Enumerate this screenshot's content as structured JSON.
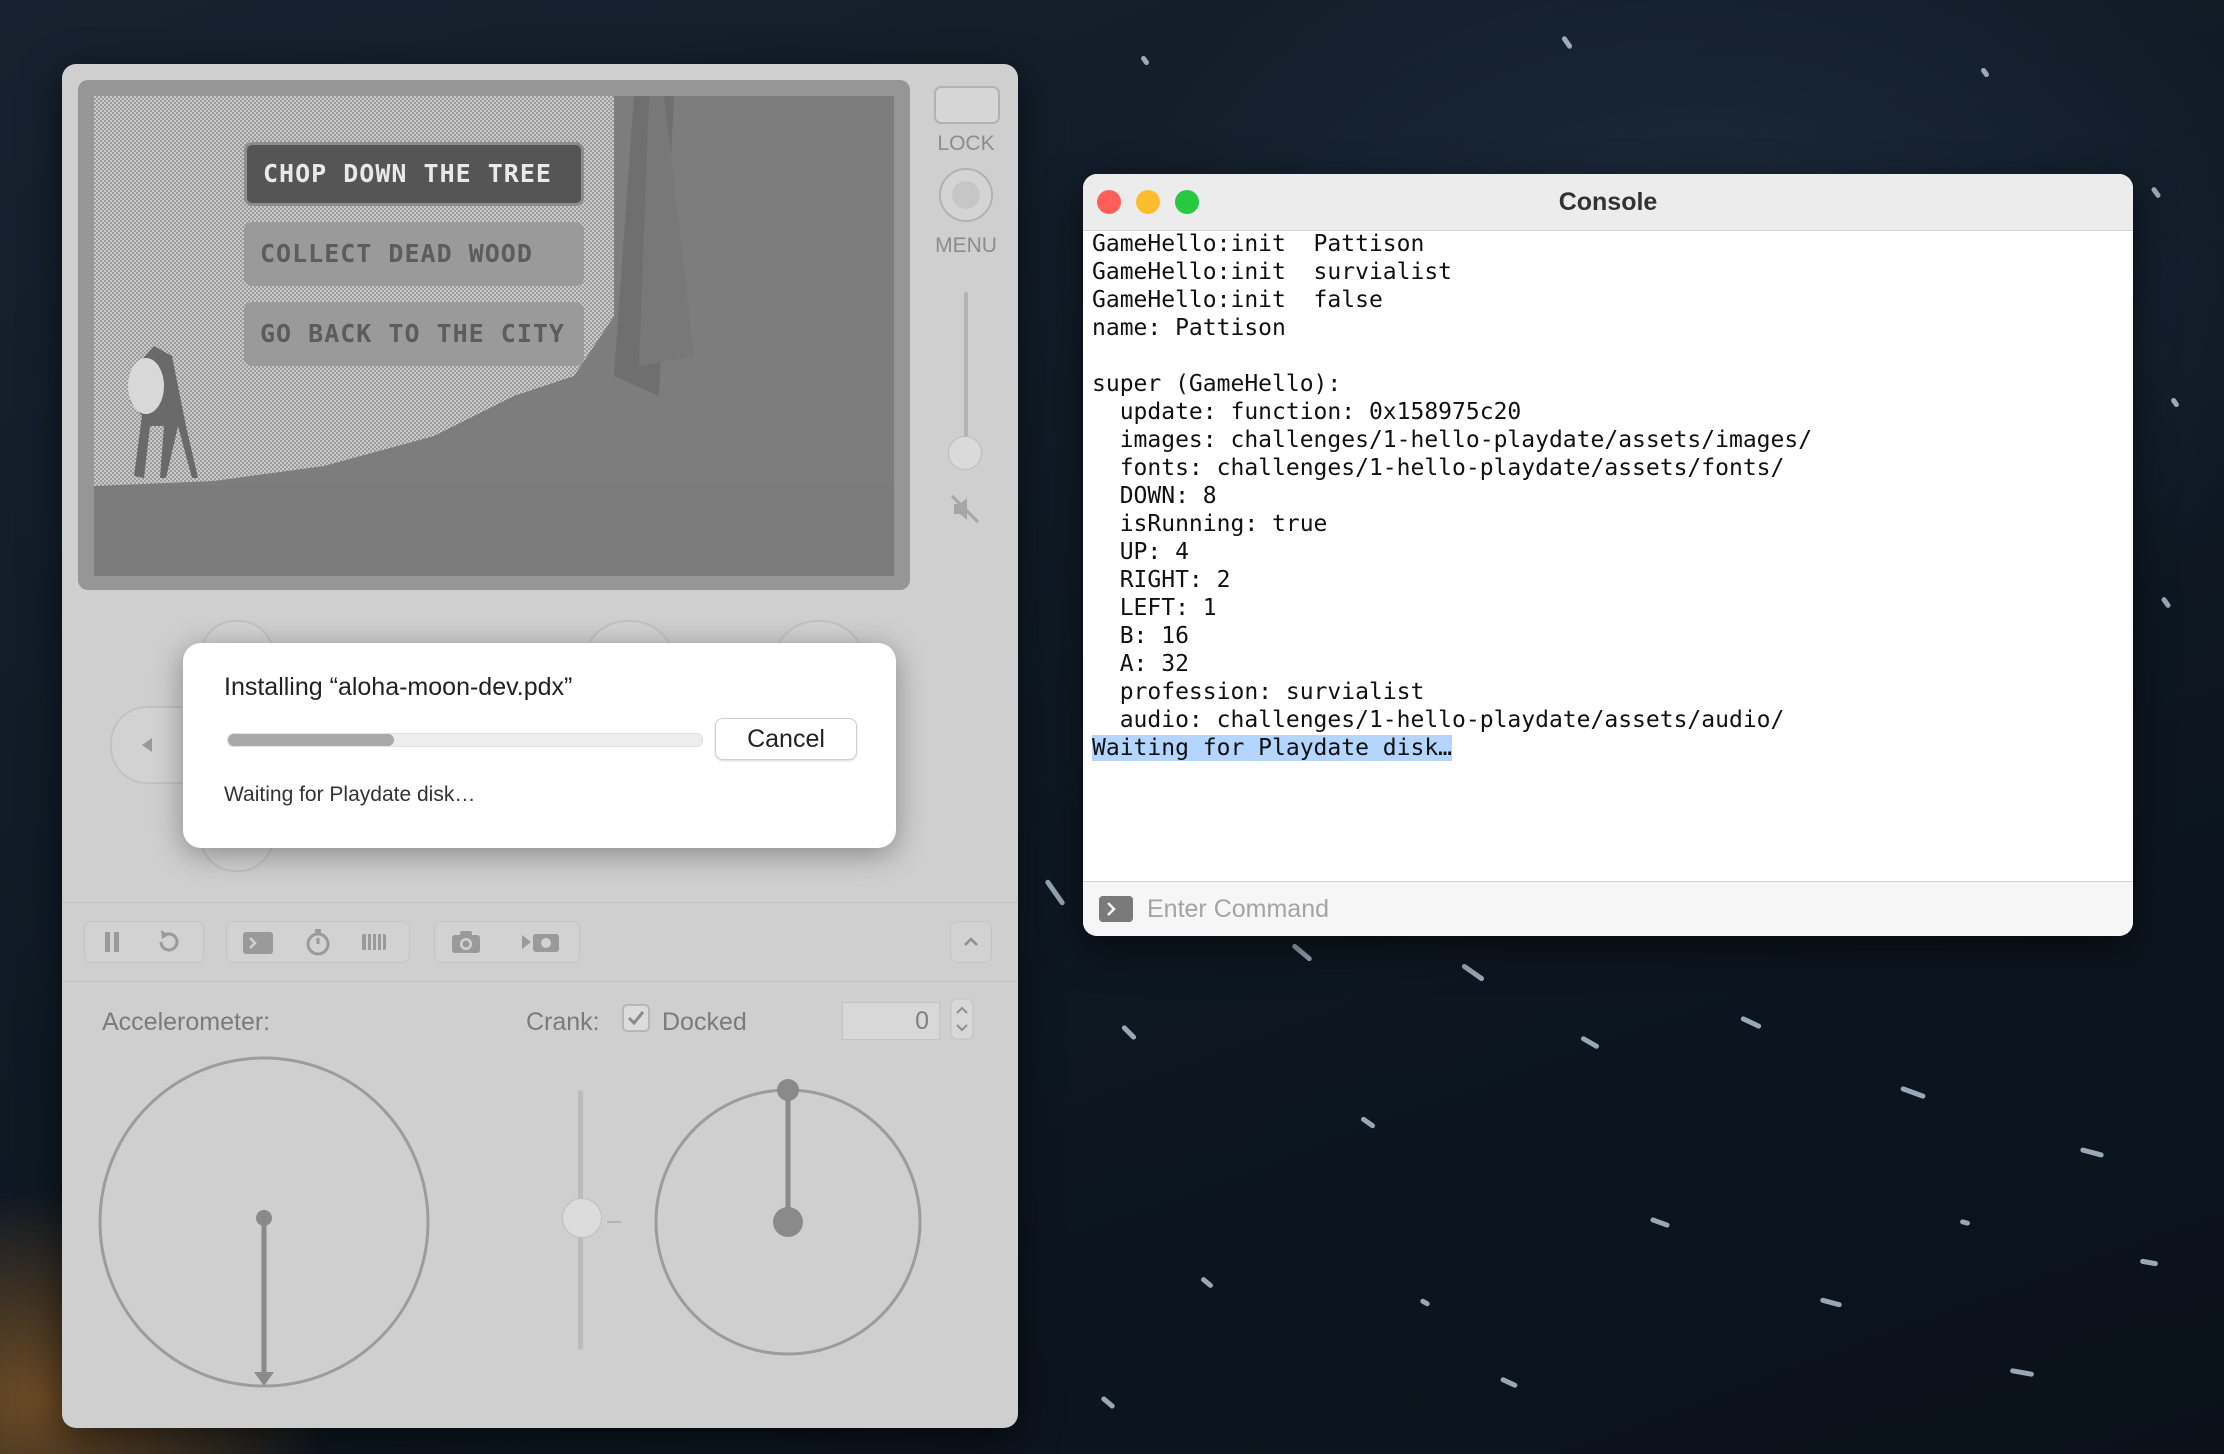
{
  "game": {
    "options": [
      "CHOP DOWN THE TREE",
      "COLLECT DEAD WOOD",
      "GO BACK TO THE CITY"
    ],
    "selected_index": 0
  },
  "simulator": {
    "lock_label": "LOCK",
    "menu_label": "MENU",
    "accelerometer_label": "Accelerometer:",
    "crank_label": "Crank:",
    "docked_label": "Docked",
    "docked_checked": true,
    "crank_value": "0",
    "toolbar_icons": [
      "pause-icon",
      "restart-icon",
      "console-icon",
      "stopwatch-icon",
      "device-icon",
      "camera-icon",
      "record-icon",
      "chevron-up-icon"
    ]
  },
  "install_dialog": {
    "title": "Installing “aloha-moon-dev.pdx”",
    "progress": 0.35,
    "cancel_label": "Cancel",
    "status": "Waiting for Playdate disk…"
  },
  "console": {
    "title": "Console",
    "lines": [
      "GameHello:init  Pattison",
      "GameHello:init  survialist",
      "GameHello:init  false",
      "name: Pattison",
      "",
      "super (GameHello):",
      "  update: function: 0x158975c20",
      "  images: challenges/1-hello-playdate/assets/images/",
      "  fonts: challenges/1-hello-playdate/assets/fonts/",
      "  DOWN: 8",
      "  isRunning: true",
      "  UP: 4",
      "  RIGHT: 2",
      "  LEFT: 1",
      "  B: 16",
      "  A: 32",
      "  profession: survialist",
      "  audio: challenges/1-hello-playdate/assets/audio/"
    ],
    "highlighted_line": "Waiting for Playdate disk…",
    "command_placeholder": "Enter Command"
  },
  "colors": {
    "close": "#ff5f57",
    "minimize": "#febc2e",
    "zoom": "#28c840",
    "selection": "#b4d5fe"
  }
}
